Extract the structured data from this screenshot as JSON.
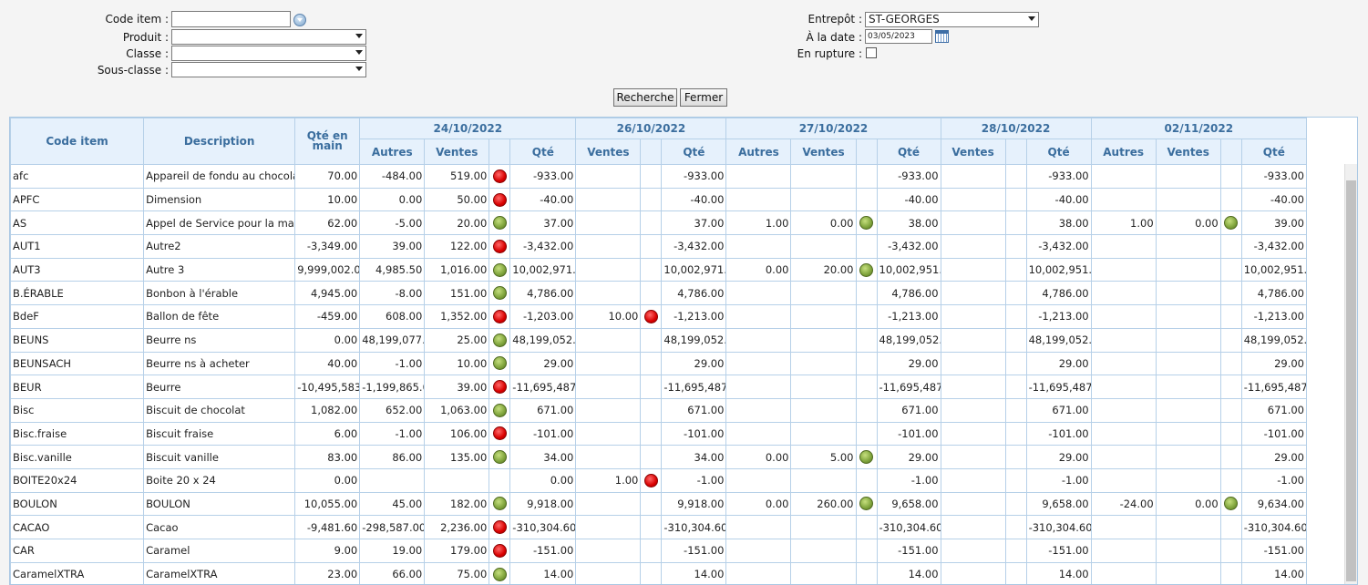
{
  "filters": {
    "code_item_label": "Code item :",
    "produit_label": "Produit :",
    "classe_label": "Classe :",
    "sous_classe_label": "Sous-classe :",
    "entrepot_label": "Entrepôt :",
    "entrepot_value": "ST-GEORGES",
    "date_label": "À la date :",
    "date_value": "03/05/2023",
    "rupture_label": "En rupture :"
  },
  "buttons": {
    "recherche": "Recherche",
    "fermer": "Fermer"
  },
  "table": {
    "fixed_headers": [
      "Code item",
      "Description",
      "Qté en main"
    ],
    "groups": [
      {
        "date": "24/10/2022",
        "cols": [
          "Autres",
          "Ventes",
          "",
          "Qté"
        ]
      },
      {
        "date": "26/10/2022",
        "cols": [
          "Ventes",
          "",
          "Qté"
        ]
      },
      {
        "date": "27/10/2022",
        "cols": [
          "Autres",
          "Ventes",
          "",
          "Qté"
        ]
      },
      {
        "date": "28/10/2022",
        "cols": [
          "Ventes",
          "",
          "Qté"
        ]
      },
      {
        "date": "02/11/2022",
        "cols": [
          "Autres",
          "Ventes",
          "",
          "Qté"
        ]
      }
    ],
    "rows": [
      {
        "code": "afc",
        "desc": "Appareil de fondu au chocolat",
        "qem": "70.00",
        "d1": {
          "autres": "-484.00",
          "ventes": "519.00",
          "dot": "red",
          "qte": "-933.00"
        },
        "d2": {
          "ventes": "",
          "dot": "",
          "qte": "-933.00"
        },
        "d3": {
          "autres": "",
          "ventes": "",
          "dot": "",
          "qte": "-933.00"
        },
        "d4": {
          "ventes": "",
          "dot": "",
          "qte": "-933.00"
        },
        "d5": {
          "autres": "",
          "ventes": "",
          "dot": "",
          "qte": "-933.00"
        }
      },
      {
        "code": "APFC",
        "desc": "Dimension",
        "qem": "10.00",
        "d1": {
          "autres": "0.00",
          "ventes": "50.00",
          "dot": "red",
          "qte": "-40.00"
        },
        "d2": {
          "ventes": "",
          "dot": "",
          "qte": "-40.00"
        },
        "d3": {
          "autres": "",
          "ventes": "",
          "dot": "",
          "qte": "-40.00"
        },
        "d4": {
          "ventes": "",
          "dot": "",
          "qte": "-40.00"
        },
        "d5": {
          "autres": "",
          "ventes": "",
          "dot": "",
          "qte": "-40.00"
        }
      },
      {
        "code": "AS",
        "desc": "Appel de Service pour la machine",
        "qem": "62.00",
        "d1": {
          "autres": "-5.00",
          "ventes": "20.00",
          "dot": "green",
          "qte": "37.00"
        },
        "d2": {
          "ventes": "",
          "dot": "",
          "qte": "37.00"
        },
        "d3": {
          "autres": "1.00",
          "ventes": "0.00",
          "dot": "green",
          "qte": "38.00"
        },
        "d4": {
          "ventes": "",
          "dot": "",
          "qte": "38.00"
        },
        "d5": {
          "autres": "1.00",
          "ventes": "0.00",
          "dot": "green",
          "qte": "39.00"
        }
      },
      {
        "code": "AUT1",
        "desc": "Autre2",
        "qem": "-3,349.00",
        "d1": {
          "autres": "39.00",
          "ventes": "122.00",
          "dot": "red",
          "qte": "-3,432.00"
        },
        "d2": {
          "ventes": "",
          "dot": "",
          "qte": "-3,432.00"
        },
        "d3": {
          "autres": "",
          "ventes": "",
          "dot": "",
          "qte": "-3,432.00"
        },
        "d4": {
          "ventes": "",
          "dot": "",
          "qte": "-3,432.00"
        },
        "d5": {
          "autres": "",
          "ventes": "",
          "dot": "",
          "qte": "-3,432.00"
        }
      },
      {
        "code": "AUT3",
        "desc": "Autre 3",
        "qem": "9,999,002.00",
        "d1": {
          "autres": "4,985.50",
          "ventes": "1,016.00",
          "dot": "green",
          "qte": "10,002,971.5"
        },
        "d2": {
          "ventes": "",
          "dot": "",
          "qte": "10,002,971.5"
        },
        "d3": {
          "autres": "0.00",
          "ventes": "20.00",
          "dot": "green",
          "qte": "10,002,951.5"
        },
        "d4": {
          "ventes": "",
          "dot": "",
          "qte": "10,002,951.5"
        },
        "d5": {
          "autres": "",
          "ventes": "",
          "dot": "",
          "qte": "10,002,951.5"
        }
      },
      {
        "code": "B.ÉRABLE",
        "desc": "Bonbon à l'érable",
        "qem": "4,945.00",
        "d1": {
          "autres": "-8.00",
          "ventes": "151.00",
          "dot": "green",
          "qte": "4,786.00"
        },
        "d2": {
          "ventes": "",
          "dot": "",
          "qte": "4,786.00"
        },
        "d3": {
          "autres": "",
          "ventes": "",
          "dot": "",
          "qte": "4,786.00"
        },
        "d4": {
          "ventes": "",
          "dot": "",
          "qte": "4,786.00"
        },
        "d5": {
          "autres": "",
          "ventes": "",
          "dot": "",
          "qte": "4,786.00"
        }
      },
      {
        "code": "BdeF",
        "desc": "Ballon de fête",
        "qem": "-459.00",
        "d1": {
          "autres": "608.00",
          "ventes": "1,352.00",
          "dot": "red",
          "qte": "-1,203.00"
        },
        "d2": {
          "ventes": "10.00",
          "dot": "red",
          "qte": "-1,213.00"
        },
        "d3": {
          "autres": "",
          "ventes": "",
          "dot": "",
          "qte": "-1,213.00"
        },
        "d4": {
          "ventes": "",
          "dot": "",
          "qte": "-1,213.00"
        },
        "d5": {
          "autres": "",
          "ventes": "",
          "dot": "",
          "qte": "-1,213.00"
        }
      },
      {
        "code": "BEUNS",
        "desc": "Beurre ns",
        "qem": "0.00",
        "d1": {
          "autres": "48,199,077.0",
          "ventes": "25.00",
          "dot": "green",
          "qte": "48,199,052.0"
        },
        "d2": {
          "ventes": "",
          "dot": "",
          "qte": "48,199,052.0"
        },
        "d3": {
          "autres": "",
          "ventes": "",
          "dot": "",
          "qte": "48,199,052.0"
        },
        "d4": {
          "ventes": "",
          "dot": "",
          "qte": "48,199,052.0"
        },
        "d5": {
          "autres": "",
          "ventes": "",
          "dot": "",
          "qte": "48,199,052.0"
        }
      },
      {
        "code": "BEUNSACH",
        "desc": "Beurre ns à acheter",
        "qem": "40.00",
        "d1": {
          "autres": "-1.00",
          "ventes": "10.00",
          "dot": "green",
          "qte": "29.00"
        },
        "d2": {
          "ventes": "",
          "dot": "",
          "qte": "29.00"
        },
        "d3": {
          "autres": "",
          "ventes": "",
          "dot": "",
          "qte": "29.00"
        },
        "d4": {
          "ventes": "",
          "dot": "",
          "qte": "29.00"
        },
        "d5": {
          "autres": "",
          "ventes": "",
          "dot": "",
          "qte": "29.00"
        }
      },
      {
        "code": "BEUR",
        "desc": "Beurre",
        "qem": "-10,495,583.0",
        "d1": {
          "autres": "-1,199,865.00",
          "ventes": "39.00",
          "dot": "red",
          "qte": "-11,695,487.0"
        },
        "d2": {
          "ventes": "",
          "dot": "",
          "qte": "-11,695,487.0"
        },
        "d3": {
          "autres": "",
          "ventes": "",
          "dot": "",
          "qte": "-11,695,487.0"
        },
        "d4": {
          "ventes": "",
          "dot": "",
          "qte": "-11,695,487.0"
        },
        "d5": {
          "autres": "",
          "ventes": "",
          "dot": "",
          "qte": "-11,695,487.0"
        }
      },
      {
        "code": "Bisc",
        "desc": "Biscuit de chocolat",
        "qem": "1,082.00",
        "d1": {
          "autres": "652.00",
          "ventes": "1,063.00",
          "dot": "green",
          "qte": "671.00"
        },
        "d2": {
          "ventes": "",
          "dot": "",
          "qte": "671.00"
        },
        "d3": {
          "autres": "",
          "ventes": "",
          "dot": "",
          "qte": "671.00"
        },
        "d4": {
          "ventes": "",
          "dot": "",
          "qte": "671.00"
        },
        "d5": {
          "autres": "",
          "ventes": "",
          "dot": "",
          "qte": "671.00"
        }
      },
      {
        "code": "Bisc.fraise",
        "desc": "Biscuit fraise",
        "qem": "6.00",
        "d1": {
          "autres": "-1.00",
          "ventes": "106.00",
          "dot": "red",
          "qte": "-101.00"
        },
        "d2": {
          "ventes": "",
          "dot": "",
          "qte": "-101.00"
        },
        "d3": {
          "autres": "",
          "ventes": "",
          "dot": "",
          "qte": "-101.00"
        },
        "d4": {
          "ventes": "",
          "dot": "",
          "qte": "-101.00"
        },
        "d5": {
          "autres": "",
          "ventes": "",
          "dot": "",
          "qte": "-101.00"
        }
      },
      {
        "code": "Bisc.vanille",
        "desc": "Biscuit vanille",
        "qem": "83.00",
        "d1": {
          "autres": "86.00",
          "ventes": "135.00",
          "dot": "green",
          "qte": "34.00"
        },
        "d2": {
          "ventes": "",
          "dot": "",
          "qte": "34.00"
        },
        "d3": {
          "autres": "0.00",
          "ventes": "5.00",
          "dot": "green",
          "qte": "29.00"
        },
        "d4": {
          "ventes": "",
          "dot": "",
          "qte": "29.00"
        },
        "d5": {
          "autres": "",
          "ventes": "",
          "dot": "",
          "qte": "29.00"
        }
      },
      {
        "code": "BOITE20x24",
        "desc": "Boite 20 x 24",
        "qem": "0.00",
        "d1": {
          "autres": "",
          "ventes": "",
          "dot": "",
          "qte": "0.00"
        },
        "d2": {
          "ventes": "1.00",
          "dot": "red",
          "qte": "-1.00"
        },
        "d3": {
          "autres": "",
          "ventes": "",
          "dot": "",
          "qte": "-1.00"
        },
        "d4": {
          "ventes": "",
          "dot": "",
          "qte": "-1.00"
        },
        "d5": {
          "autres": "",
          "ventes": "",
          "dot": "",
          "qte": "-1.00"
        }
      },
      {
        "code": "BOULON",
        "desc": "BOULON",
        "qem": "10,055.00",
        "d1": {
          "autres": "45.00",
          "ventes": "182.00",
          "dot": "green",
          "qte": "9,918.00"
        },
        "d2": {
          "ventes": "",
          "dot": "",
          "qte": "9,918.00"
        },
        "d3": {
          "autres": "0.00",
          "ventes": "260.00",
          "dot": "green",
          "qte": "9,658.00"
        },
        "d4": {
          "ventes": "",
          "dot": "",
          "qte": "9,658.00"
        },
        "d5": {
          "autres": "-24.00",
          "ventes": "0.00",
          "dot": "green",
          "qte": "9,634.00"
        }
      },
      {
        "code": "CACAO",
        "desc": "Cacao",
        "qem": "-9,481.60",
        "d1": {
          "autres": "-298,587.00",
          "ventes": "2,236.00",
          "dot": "red",
          "qte": "-310,304.60"
        },
        "d2": {
          "ventes": "",
          "dot": "",
          "qte": "-310,304.60"
        },
        "d3": {
          "autres": "",
          "ventes": "",
          "dot": "",
          "qte": "-310,304.60"
        },
        "d4": {
          "ventes": "",
          "dot": "",
          "qte": "-310,304.60"
        },
        "d5": {
          "autres": "",
          "ventes": "",
          "dot": "",
          "qte": "-310,304.60"
        }
      },
      {
        "code": "CAR",
        "desc": "Caramel",
        "qem": "9.00",
        "d1": {
          "autres": "19.00",
          "ventes": "179.00",
          "dot": "red",
          "qte": "-151.00"
        },
        "d2": {
          "ventes": "",
          "dot": "",
          "qte": "-151.00"
        },
        "d3": {
          "autres": "",
          "ventes": "",
          "dot": "",
          "qte": "-151.00"
        },
        "d4": {
          "ventes": "",
          "dot": "",
          "qte": "-151.00"
        },
        "d5": {
          "autres": "",
          "ventes": "",
          "dot": "",
          "qte": "-151.00"
        }
      },
      {
        "code": "CaramelXTRA",
        "desc": "CaramelXTRA",
        "qem": "23.00",
        "d1": {
          "autres": "66.00",
          "ventes": "75.00",
          "dot": "green",
          "qte": "14.00"
        },
        "d2": {
          "ventes": "",
          "dot": "",
          "qte": "14.00"
        },
        "d3": {
          "autres": "",
          "ventes": "",
          "dot": "",
          "qte": "14.00"
        },
        "d4": {
          "ventes": "",
          "dot": "",
          "qte": "14.00"
        },
        "d5": {
          "autres": "",
          "ventes": "",
          "dot": "",
          "qte": "14.00"
        }
      }
    ]
  }
}
